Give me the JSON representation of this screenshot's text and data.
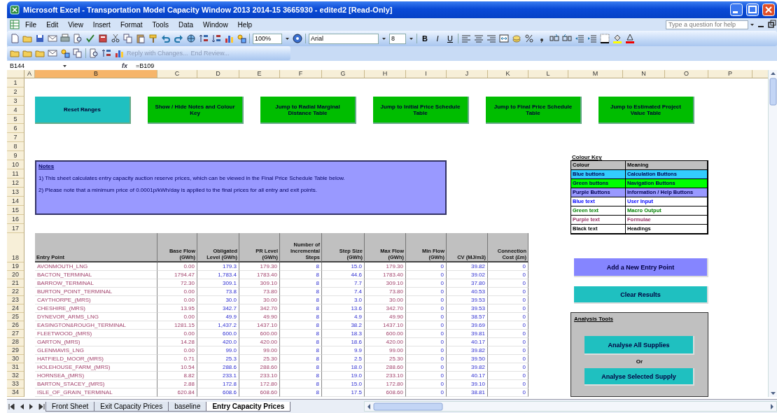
{
  "window": {
    "title": "Microsoft Excel - Transportation Model Capacity Window 2013 2014-15 3665930 - edited2 [Read-Only]"
  },
  "menu": [
    "File",
    "Edit",
    "View",
    "Insert",
    "Format",
    "Tools",
    "Data",
    "Window",
    "Help"
  ],
  "help_box": {
    "placeholder": "Type a question for help"
  },
  "toolbar": {
    "zoom": "100%",
    "font": "Arial",
    "font_size": "8",
    "format_buttons": [
      "B",
      "I",
      "U"
    ]
  },
  "review_toolbar": {
    "items": [
      {
        "label": "Reply with Changes...",
        "disabled": true
      },
      {
        "label": "End Review...",
        "disabled": true
      }
    ]
  },
  "formula_bar": {
    "cell": "B144",
    "function_label": "fx",
    "formula": "=B109"
  },
  "column_headers": [
    {
      "label": "A",
      "selected": false
    },
    {
      "label": "B",
      "selected": true
    },
    {
      "label": "C",
      "selected": false
    },
    {
      "label": "D",
      "selected": false
    },
    {
      "label": "E",
      "selected": false
    },
    {
      "label": "F",
      "selected": false
    },
    {
      "label": "G",
      "selected": false
    },
    {
      "label": "H",
      "selected": false
    },
    {
      "label": "I",
      "selected": false
    },
    {
      "label": "J",
      "selected": false
    },
    {
      "label": "K",
      "selected": false
    },
    {
      "label": "L",
      "selected": false
    },
    {
      "label": "M",
      "selected": false
    },
    {
      "label": "N",
      "selected": false
    },
    {
      "label": "O",
      "selected": false
    },
    {
      "label": "P",
      "selected": false
    }
  ],
  "row_headers": [
    "1",
    "2",
    "3",
    "4",
    "5",
    "6",
    "7",
    "8",
    "9",
    "10",
    "11",
    "12",
    "13",
    "14",
    "15",
    "16",
    "17",
    "18",
    "19",
    "20",
    "21",
    "22",
    "23",
    "24",
    "25",
    "26",
    "27",
    "28",
    "29",
    "30",
    "31",
    "32",
    "33",
    "34"
  ],
  "buttons": [
    {
      "label": "Reset Ranges",
      "kind": "calculation"
    },
    {
      "label": "Show / Hide Notes and Colour Key",
      "kind": "navigation"
    },
    {
      "label": "Jump to Radial Marginal Distance Table",
      "kind": "navigation"
    },
    {
      "label": "Jump to Initial Price Schedule Table",
      "kind": "navigation"
    },
    {
      "label": "Jump to Final Price Schedule Table",
      "kind": "navigation"
    },
    {
      "label": "Jump to Estimated Project Value Table",
      "kind": "navigation"
    }
  ],
  "notes": {
    "title": "Notes",
    "lines": [
      "1) This sheet calculates entry capacity auction reserve prices, which can be viewed in the Final Price Schedule Table below.",
      "2) Please note that a minimum price of 0.0001p/kWh/day is applied to the final prices for all entry and exit points."
    ]
  },
  "colour_key": {
    "title": "Colour Key",
    "header": [
      "Colour",
      "Meaning"
    ],
    "rows": [
      {
        "colour": "Blue buttons",
        "meaning": "Calculation Buttons",
        "kind": "fill",
        "color": "#33ccff"
      },
      {
        "colour": "Green buttons",
        "meaning": "Navigation Buttons",
        "kind": "fill",
        "color": "#00ff00"
      },
      {
        "colour": "Purple Buttons",
        "meaning": "Information / Help Buttons",
        "kind": "fill",
        "color": "#9999ff"
      },
      {
        "colour": "Blue text",
        "meaning": "User Input",
        "kind": "text",
        "color": "#0000ff"
      },
      {
        "colour": "Green text",
        "meaning": "Macro Output",
        "kind": "text",
        "color": "#008000"
      },
      {
        "colour": "Purple text",
        "meaning": "Formulae",
        "kind": "text",
        "color": "#993366"
      },
      {
        "colour": "Black text",
        "meaning": "Headings",
        "kind": "text",
        "color": "#000000"
      }
    ]
  },
  "table": {
    "columns": [
      {
        "label": "Entry Point",
        "kind": "formula"
      },
      {
        "label": "Base Flow (GWh)",
        "kind": "formula"
      },
      {
        "label": "Obligated Level (GWh)",
        "kind": "input"
      },
      {
        "label": "PR Level (GWh)",
        "kind": "formula"
      },
      {
        "label": "Number of Incremental Steps",
        "kind": "input"
      },
      {
        "label": "Step Size (GWh)",
        "kind": "input"
      },
      {
        "label": "Max Flow (GWh)",
        "kind": "formula"
      },
      {
        "label": "Min Flow (GWh)",
        "kind": "input"
      },
      {
        "label": "CV (MJ/m3)",
        "kind": "input"
      },
      {
        "label": "Connection Cost (£m)",
        "kind": "input"
      }
    ],
    "rows": [
      [
        "AVONMOUTH_LNG",
        "0.00",
        "179.3",
        "179.30",
        "8",
        "15.0",
        "179.30",
        "0",
        "39.82",
        "0"
      ],
      [
        "BACTON_TERMINAL",
        "1794.47",
        "1,783.4",
        "1783.40",
        "8",
        "44.6",
        "1783.40",
        "0",
        "39.02",
        "0"
      ],
      [
        "BARROW_TERMINAL",
        "72.30",
        "309.1",
        "309.10",
        "8",
        "7.7",
        "309.10",
        "0",
        "37.80",
        "0"
      ],
      [
        "BURTON_POINT_TERMINAL",
        "0.00",
        "73.8",
        "73.80",
        "8",
        "7.4",
        "73.80",
        "0",
        "40.53",
        "0"
      ],
      [
        "CAYTHORPE_(MRS)",
        "0.00",
        "30.0",
        "30.00",
        "8",
        "3.0",
        "30.00",
        "0",
        "39.53",
        "0"
      ],
      [
        "CHESHIRE_(MRS)",
        "13.95",
        "342.7",
        "342.70",
        "8",
        "13.6",
        "342.70",
        "0",
        "39.53",
        "0"
      ],
      [
        "DYNEVOR_ARMS_LNG",
        "0.00",
        "49.9",
        "49.90",
        "8",
        "4.9",
        "49.90",
        "0",
        "38.57",
        "0"
      ],
      [
        "EASINGTON&ROUGH_TERMINAL",
        "1281.15",
        "1,437.2",
        "1437.10",
        "8",
        "38.2",
        "1437.10",
        "0",
        "39.69",
        "0"
      ],
      [
        "FLEETWOOD_(MRS)",
        "0.00",
        "600.0",
        "600.00",
        "8",
        "18.3",
        "600.00",
        "0",
        "39.81",
        "0"
      ],
      [
        "GARTON_(MRS)",
        "14.28",
        "420.0",
        "420.00",
        "8",
        "18.6",
        "420.00",
        "0",
        "40.17",
        "0"
      ],
      [
        "GLENMAVIS_LNG",
        "0.00",
        "99.0",
        "99.00",
        "8",
        "9.9",
        "99.00",
        "0",
        "39.82",
        "0"
      ],
      [
        "HATFIELD_MOOR_(MRS)",
        "0.71",
        "25.3",
        "25.30",
        "8",
        "2.5",
        "25.30",
        "0",
        "39.50",
        "0"
      ],
      [
        "HOLEHOUSE_FARM_(MRS)",
        "10.54",
        "288.6",
        "288.60",
        "8",
        "18.0",
        "288.60",
        "0",
        "39.82",
        "0"
      ],
      [
        "HORNSEA_(MRS)",
        "8.82",
        "233.1",
        "233.10",
        "8",
        "19.0",
        "233.10",
        "0",
        "40.17",
        "0"
      ],
      [
        "BARTON_STACEY_(MRS)",
        "2.88",
        "172.8",
        "172.80",
        "8",
        "15.0",
        "172.80",
        "0",
        "39.10",
        "0"
      ],
      [
        "ISLE_OF_GRAIN_TERMINAL",
        "620.84",
        "608.6",
        "608.60",
        "8",
        "17.5",
        "608.60",
        "0",
        "38.81",
        "0"
      ]
    ]
  },
  "side_buttons": [
    {
      "label": "Add a New Entry Point",
      "kind": "information"
    },
    {
      "label": "Clear Results",
      "kind": "calculation"
    }
  ],
  "analysis_tools": {
    "title": "Analysis Tools",
    "separator": "Or",
    "buttons": [
      {
        "label": "Analyse All Supplies",
        "kind": "calculation"
      },
      {
        "label": "Analyse Selected Supply",
        "kind": "calculation"
      }
    ]
  },
  "sheet_tabs": [
    {
      "label": "Front Sheet",
      "selected": false
    },
    {
      "label": "Exit Capacity Prices",
      "selected": false
    },
    {
      "label": "baseline",
      "selected": false
    },
    {
      "label": "Entry Capacity Prices",
      "selected": true
    }
  ]
}
